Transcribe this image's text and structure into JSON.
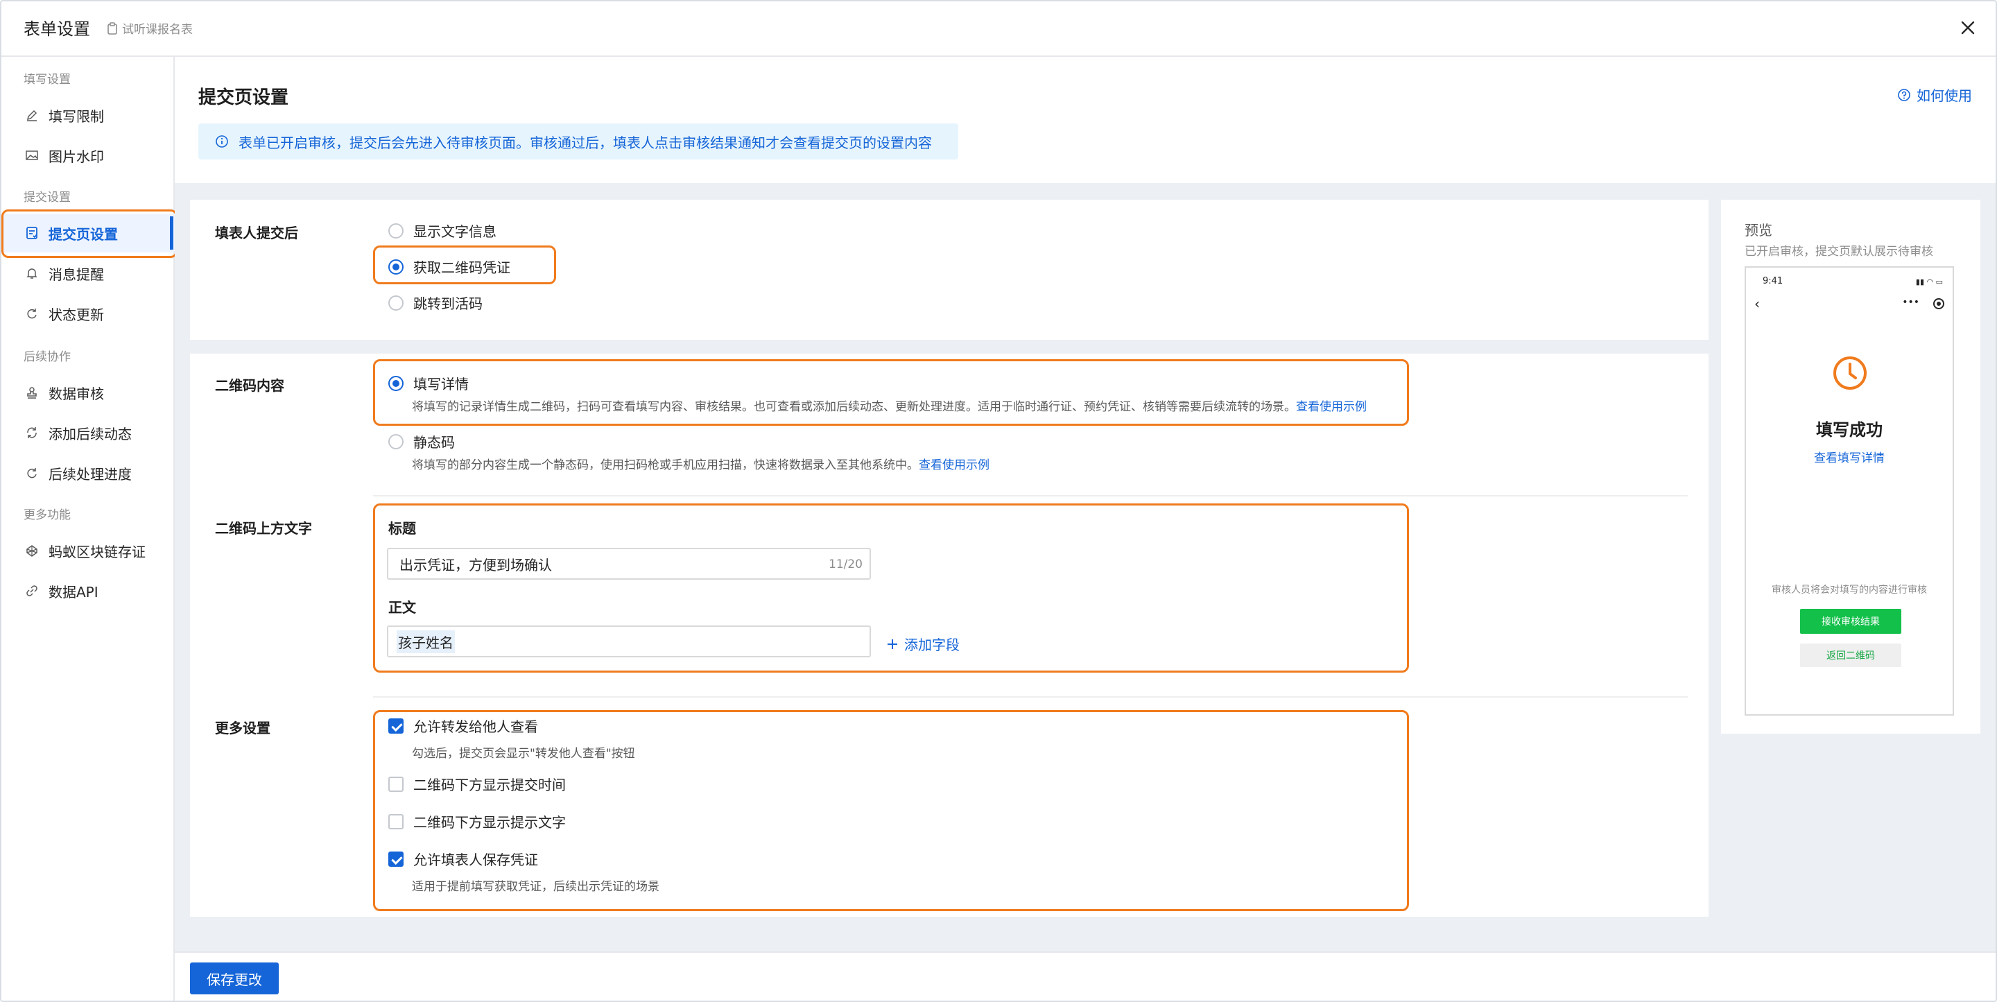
{
  "header": {
    "title": "表单设置",
    "subtitle": "试听课报名表"
  },
  "sidebar": {
    "sections": [
      {
        "label": "填写设置",
        "items": [
          {
            "label": "填写限制",
            "icon": "pen-icon"
          },
          {
            "label": "图片水印",
            "icon": "image-icon"
          }
        ]
      },
      {
        "label": "提交设置",
        "items": [
          {
            "label": "提交页设置",
            "icon": "form-icon",
            "active": true
          },
          {
            "label": "消息提醒",
            "icon": "bell-icon"
          },
          {
            "label": "状态更新",
            "icon": "refresh-icon"
          }
        ]
      },
      {
        "label": "后续协作",
        "items": [
          {
            "label": "数据审核",
            "icon": "stamp-icon"
          },
          {
            "label": "添加后续动态",
            "icon": "cycle-icon"
          },
          {
            "label": "后续处理进度",
            "icon": "refresh-icon"
          }
        ]
      },
      {
        "label": "更多功能",
        "items": [
          {
            "label": "蚂蚁区块链存证",
            "icon": "chain-icon"
          },
          {
            "label": "数据API",
            "icon": "link-icon"
          }
        ]
      }
    ]
  },
  "main": {
    "title": "提交页设置",
    "help": "如何使用",
    "notice": "表单已开启审核，提交后会先进入待审核页面。审核通过后，填表人点击审核结果通知才会查看提交页的设置内容",
    "after_submit": {
      "label": "填表人提交后",
      "options": [
        {
          "label": "显示文字信息",
          "selected": false
        },
        {
          "label": "获取二维码凭证",
          "selected": true
        },
        {
          "label": "跳转到活码",
          "selected": false
        }
      ]
    },
    "qr_content": {
      "label": "二维码内容",
      "options": [
        {
          "label": "填写详情",
          "selected": true,
          "desc": "将填写的记录详情生成二维码，扫码可查看填写内容、审核结果。也可查看或添加后续动态、更新处理进度。适用于临时通行证、预约凭证、核销等需要后续流转的场景。",
          "link": "查看使用示例"
        },
        {
          "label": "静态码",
          "selected": false,
          "desc": "将填写的部分内容生成一个静态码，使用扫码枪或手机应用扫描，快速将数据录入至其他系统中。",
          "link": "查看使用示例"
        }
      ]
    },
    "qr_text": {
      "label": "二维码上方文字",
      "title_label": "标题",
      "title_value": "出示凭证，方便到场确认",
      "title_counter": "11/20",
      "body_label": "正文",
      "body_chip": "孩子姓名",
      "add_field": "添加字段"
    },
    "more": {
      "label": "更多设置",
      "options": [
        {
          "label": "允许转发给他人查看",
          "checked": true,
          "hint": "勾选后，提交页会显示\"转发他人查看\"按钮"
        },
        {
          "label": "二维码下方显示提交时间",
          "checked": false
        },
        {
          "label": "二维码下方显示提示文字",
          "checked": false
        },
        {
          "label": "允许填表人保存凭证",
          "checked": true,
          "hint": "适用于提前填写获取凭证，后续出示凭证的场景"
        }
      ]
    },
    "save": "保存更改"
  },
  "preview": {
    "title": "预览",
    "subtitle": "已开启审核，提交页默认展示待审核",
    "phone": {
      "time": "9:41",
      "heading": "填写成功",
      "view_link": "查看填写详情",
      "audit_text": "审核人员将会对填写的内容进行审核",
      "primary_btn": "接收审核结果",
      "secondary_btn": "返回二维码"
    }
  },
  "colors": {
    "accent": "#1565d8",
    "highlight": "#f07b1d",
    "success": "#12c04a",
    "clock": "#f07b1d"
  }
}
